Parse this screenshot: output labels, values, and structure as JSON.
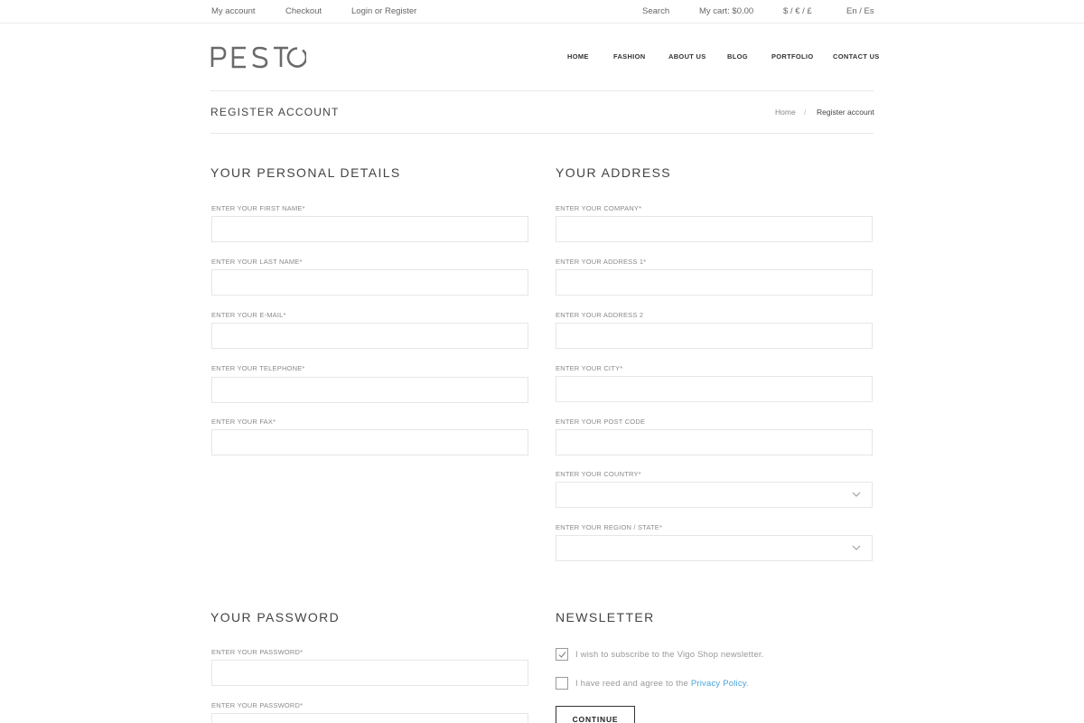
{
  "topbar": {
    "my_account": "My account",
    "checkout": "Checkout",
    "login_register": "Login or Register",
    "search": "Search",
    "cart": "My cart: $0.00",
    "currency": "$ / € / £",
    "language": "En / Es"
  },
  "header": {
    "logo_text": "PESTO",
    "nav": [
      "HOME",
      "FASHION",
      "ABOUT US",
      "BLOG",
      "PORTFOLIO",
      "CONTACT US"
    ]
  },
  "page": {
    "title": "REGISTER ACCOUNT",
    "breadcrumb": {
      "home": "Home",
      "separator": "/",
      "current": "Register account"
    }
  },
  "personal": {
    "title": "YOUR PERSONAL DETAILS",
    "fields": [
      {
        "label": "ENTER YOUR FIRST NAME*",
        "value": ""
      },
      {
        "label": "ENTER YOUR LAST NAME*",
        "value": ""
      },
      {
        "label": "ENTER YOUR E-MAIL*",
        "value": ""
      },
      {
        "label": "ENTER YOUR TELEPHONE*",
        "value": ""
      },
      {
        "label": "ENTER YOUR FAX*",
        "value": ""
      }
    ]
  },
  "address": {
    "title": "YOUR ADDRESS",
    "fields": [
      {
        "label": "ENTER YOUR COMPANY*",
        "value": ""
      },
      {
        "label": "ENTER YOUR ADDRESS 1*",
        "value": ""
      },
      {
        "label": "ENTER YOUR ADDRESS 2",
        "value": ""
      },
      {
        "label": "ENTER YOUR CITY*",
        "value": ""
      },
      {
        "label": "ENTER YOUR POST CODE",
        "value": ""
      },
      {
        "label": "ENTER YOUR COUNTRY*",
        "value": ""
      },
      {
        "label": "ENTER YOUR REGION / STATE*",
        "value": ""
      }
    ]
  },
  "password": {
    "title": "YOUR PASSWORD",
    "fields": [
      {
        "label": "ENTER YOUR PASSWORD*",
        "value": ""
      },
      {
        "label": "ENTER YOUR PASSWORD*",
        "value": ""
      }
    ]
  },
  "newsletter": {
    "title": "NEWSLETTER",
    "subscribe_label": "I wish to subscribe to the Vigo Shop newsletter.",
    "subscribe_checked": true,
    "agree_label": "I have reed and agree to the",
    "agree_link": "Privacy Policy",
    "agree_suffix": ".",
    "agree_checked": false,
    "continue_label": "CONTINUE"
  },
  "colors": {
    "link_accent": "#4aa3d8",
    "text_dark": "#444444",
    "border": "#e6e6e6"
  }
}
